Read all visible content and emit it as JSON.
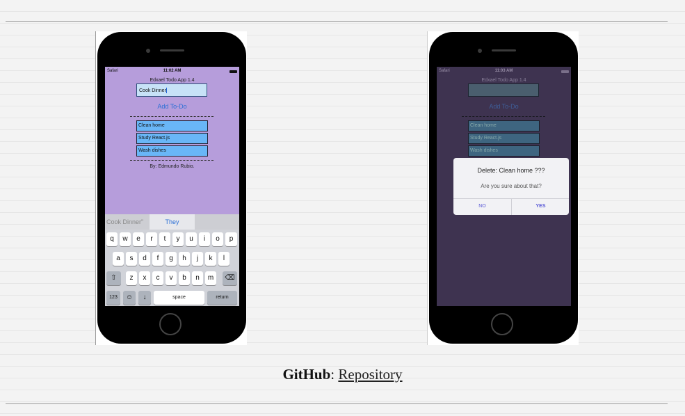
{
  "left_screenshot": {
    "status": {
      "carrier": "Safari",
      "time": "11:02 AM"
    },
    "app_title": "Edxael Todo App 1.4",
    "input_value": "Cook Dinner",
    "add_button": "Add To-Do",
    "todos": [
      "Clean home",
      "Study React.js",
      "Wash dishes"
    ],
    "credit": "By: Edmundo Rubio.",
    "suggestions": [
      "Cook Dinner”",
      "They"
    ],
    "keyboard": {
      "row1": [
        "q",
        "w",
        "e",
        "r",
        "t",
        "y",
        "u",
        "i",
        "o",
        "p"
      ],
      "row2": [
        "a",
        "s",
        "d",
        "f",
        "g",
        "h",
        "j",
        "k",
        "l"
      ],
      "row3": [
        "z",
        "x",
        "c",
        "v",
        "b",
        "n",
        "m"
      ],
      "shift": "⇧",
      "delete": "⌫",
      "numbers": "123",
      "emoji": "☺",
      "mic": "↓",
      "space": "space",
      "return": "return"
    }
  },
  "right_screenshot": {
    "status": {
      "carrier": "Safari",
      "time": "11:03 AM"
    },
    "app_title": "Edxael Todo App 1.4",
    "add_button": "Add To-Do",
    "todos": [
      "Clean home",
      "Study React.js",
      "Wash dishes"
    ],
    "dialog": {
      "title": "Delete: Clean home ???",
      "message": "Are you sure about that?",
      "no": "NO",
      "yes": "YES"
    }
  },
  "footer": {
    "label": "GitHub",
    "separator": ":",
    "link": "Repository"
  }
}
